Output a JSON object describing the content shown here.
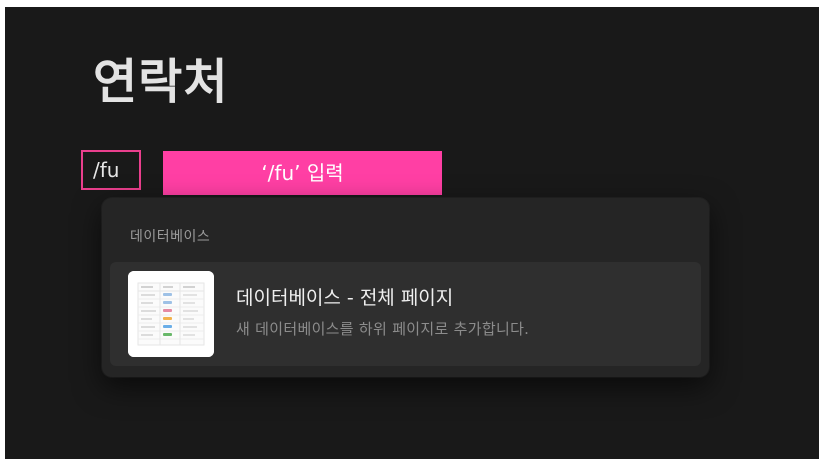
{
  "page": {
    "title": "연락처"
  },
  "editor": {
    "typed_command": "/fu"
  },
  "annotation": {
    "label": "‘/fu’ 입력",
    "color": "#ff3fa4",
    "border_color": "#ea3f8d"
  },
  "popup": {
    "section_label": "데이터베이스",
    "items": [
      {
        "title": "데이터베이스 - 전체 페이지",
        "description": "새 데이터베이스를 하위 페이지로 추가합니다.",
        "icon": "database-table-icon"
      }
    ]
  },
  "colors": {
    "background": "#191919",
    "popup": "#252525",
    "item_highlight": "#2f2f2f"
  }
}
